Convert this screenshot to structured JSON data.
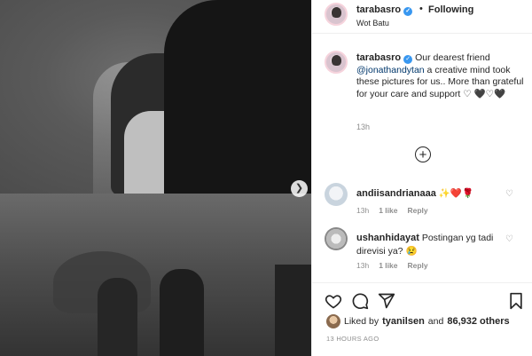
{
  "post": {
    "author": "tarabasro",
    "follow_status": "Following",
    "location": "Wot Batu",
    "caption_pre": "Our dearest friend ",
    "caption_mention": "@jonathandytan",
    "caption_post": " a creative mind took these pictures for us.. More than grateful for your care and support ♡ 🖤♡🖤",
    "caption_time": "13h"
  },
  "comments": [
    {
      "author": "andiisandrianaaa",
      "text": "✨❤️🌹",
      "time": "13h",
      "likes": "1 like",
      "reply": "Reply"
    },
    {
      "author": "ushanhidayat",
      "text": "Postingan yg tadi direvisi ya? 😢",
      "time": "13h",
      "likes": "1 like",
      "reply": "Reply"
    }
  ],
  "engagement": {
    "liked_by_prefix": "Liked by",
    "liked_by_user": "tyanilsen",
    "liked_by_mid": "and",
    "others": "86,932 others",
    "timestamp": "13 HOURS AGO"
  },
  "icons": {
    "verified": "verified-badge-icon",
    "heart": "heart-icon",
    "comment": "comment-icon",
    "share": "share-icon",
    "save": "bookmark-icon",
    "load_more": "plus-circle-icon",
    "next": "chevron-right-icon"
  },
  "colors": {
    "accent": "#3897f0",
    "mention": "#00376b",
    "muted": "#8e8e8e"
  }
}
